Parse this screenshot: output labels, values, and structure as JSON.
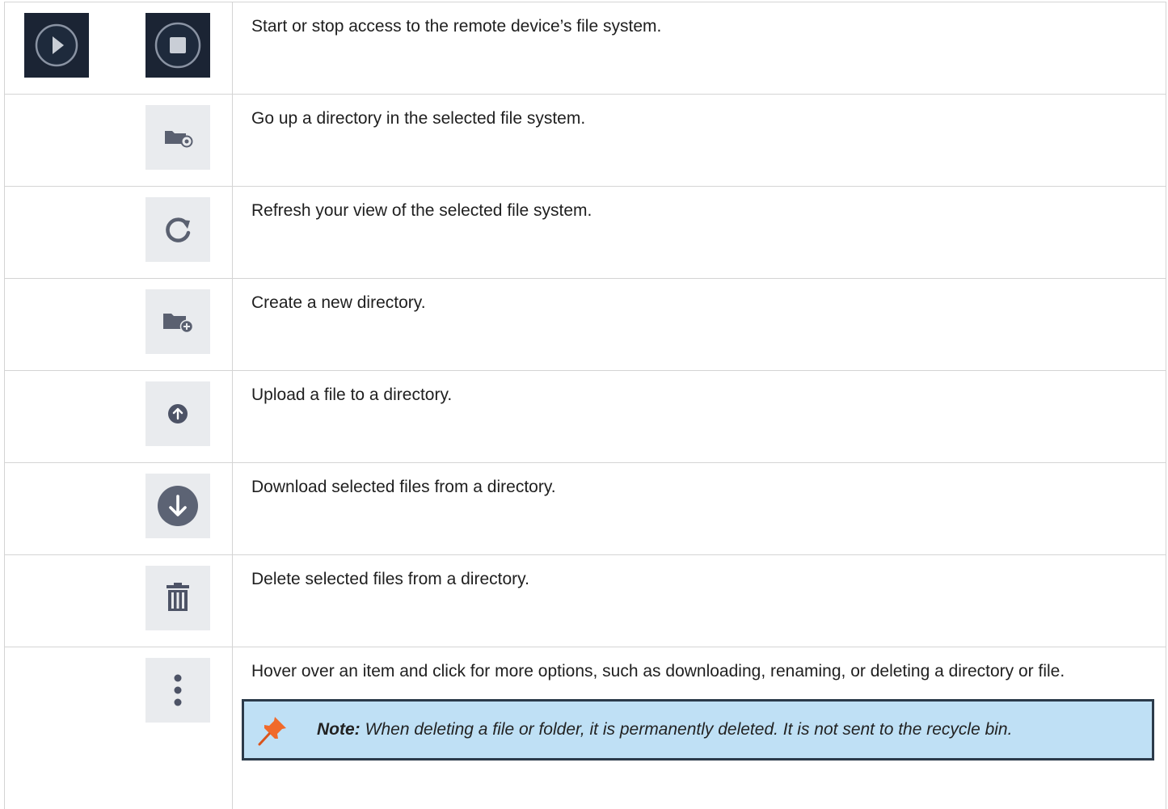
{
  "rows": [
    {
      "description": "Start or stop access to the remote device’s file system.",
      "icons": [
        "play-icon",
        "stop-icon"
      ]
    },
    {
      "description": "Go up a directory in the selected file system.",
      "icons": [
        "folder-up-icon"
      ]
    },
    {
      "description": "Refresh your view of the selected file system.",
      "icons": [
        "refresh-icon"
      ]
    },
    {
      "description": "Create a new directory.",
      "icons": [
        "new-folder-icon"
      ]
    },
    {
      "description": "Upload a file to a directory.",
      "icons": [
        "upload-icon"
      ]
    },
    {
      "description": "Download selected files from a directory.",
      "icons": [
        "download-icon"
      ]
    },
    {
      "description": "Delete selected files from a directory.",
      "icons": [
        "trash-icon"
      ]
    },
    {
      "description": "Hover over an item and click for more options, such as downloading, renaming, or deleting a directory or file.",
      "icons": [
        "more-options-icon"
      ]
    }
  ],
  "note": {
    "label": "Note:",
    "text": "When deleting a file or folder, it is permanently deleted. It is not sent to the recycle bin.",
    "icon": "pushpin-icon"
  },
  "colors": {
    "tile_light": "#e9ebee",
    "tile_dark": "#1b2434",
    "icon_gray": "#5a6070",
    "note_bg": "#bfe0f5",
    "note_border": "#2b3a4a",
    "pin": "#f06a2a"
  }
}
